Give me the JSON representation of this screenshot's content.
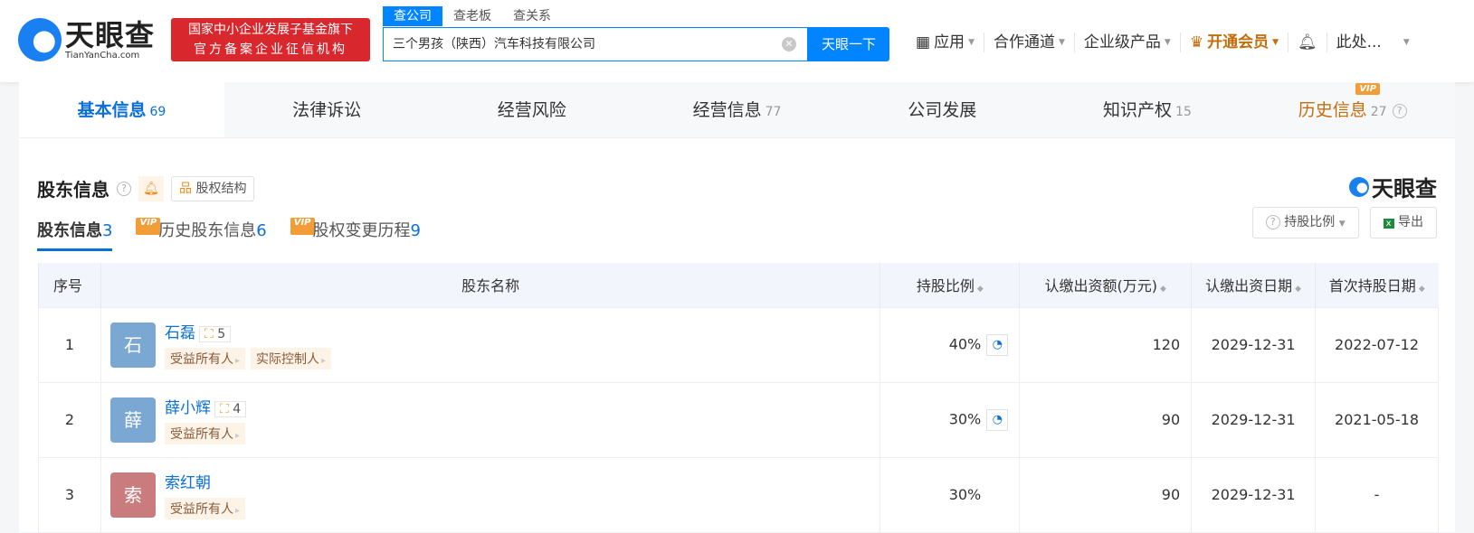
{
  "header": {
    "logo_cn": "天眼查",
    "logo_en": "TianYanCha.com",
    "slogan_1": "国家中小企业发展子基金旗下",
    "slogan_2": "官方备案企业征信机构",
    "search_tabs": [
      "查公司",
      "查老板",
      "查关系"
    ],
    "search_value": "三个男孩（陕西）汽车科技有限公司",
    "search_button": "天眼一下",
    "nav": {
      "apps": "应用",
      "partner": "合作通道",
      "enterprise": "企业级产品",
      "vip": "开通会员",
      "user": "此处..."
    }
  },
  "tabs": [
    {
      "label": "基本信息",
      "count": "69"
    },
    {
      "label": "法律诉讼",
      "count": ""
    },
    {
      "label": "经营风险",
      "count": ""
    },
    {
      "label": "经营信息",
      "count": "77"
    },
    {
      "label": "公司发展",
      "count": ""
    },
    {
      "label": "知识产权",
      "count": "15"
    },
    {
      "label": "历史信息",
      "count": "27"
    }
  ],
  "vip_badge": "VIP",
  "section": {
    "title": "股东信息",
    "structure_button": "股权结构",
    "brand": "天眼查",
    "subtabs": [
      {
        "label": "股东信息",
        "count": "3"
      },
      {
        "label": "历史股东信息",
        "count": "6"
      },
      {
        "label": "股权变更历程",
        "count": "9"
      }
    ],
    "ratio_button": "持股比例",
    "export_button": "导出"
  },
  "table": {
    "headers": [
      "序号",
      "股东名称",
      "持股比例",
      "认缴出资额(万元)",
      "认缴出资日期",
      "首次持股日期"
    ],
    "rows": [
      {
        "no": "1",
        "avatar": "石",
        "name": "石磊",
        "related": "5",
        "tags": [
          "受益所有人",
          "实际控制人"
        ],
        "ratio": "40%",
        "amount": "120",
        "sub_date": "2029-12-31",
        "first_date": "2022-07-12"
      },
      {
        "no": "2",
        "avatar": "薛",
        "name": "薛小辉",
        "related": "4",
        "tags": [
          "受益所有人"
        ],
        "ratio": "30%",
        "amount": "90",
        "sub_date": "2029-12-31",
        "first_date": "2021-05-18"
      },
      {
        "no": "3",
        "avatar": "索",
        "name": "索红朝",
        "related": "",
        "tags": [
          "受益所有人"
        ],
        "ratio": "30%",
        "amount": "90",
        "sub_date": "2029-12-31",
        "first_date": "-"
      }
    ]
  }
}
